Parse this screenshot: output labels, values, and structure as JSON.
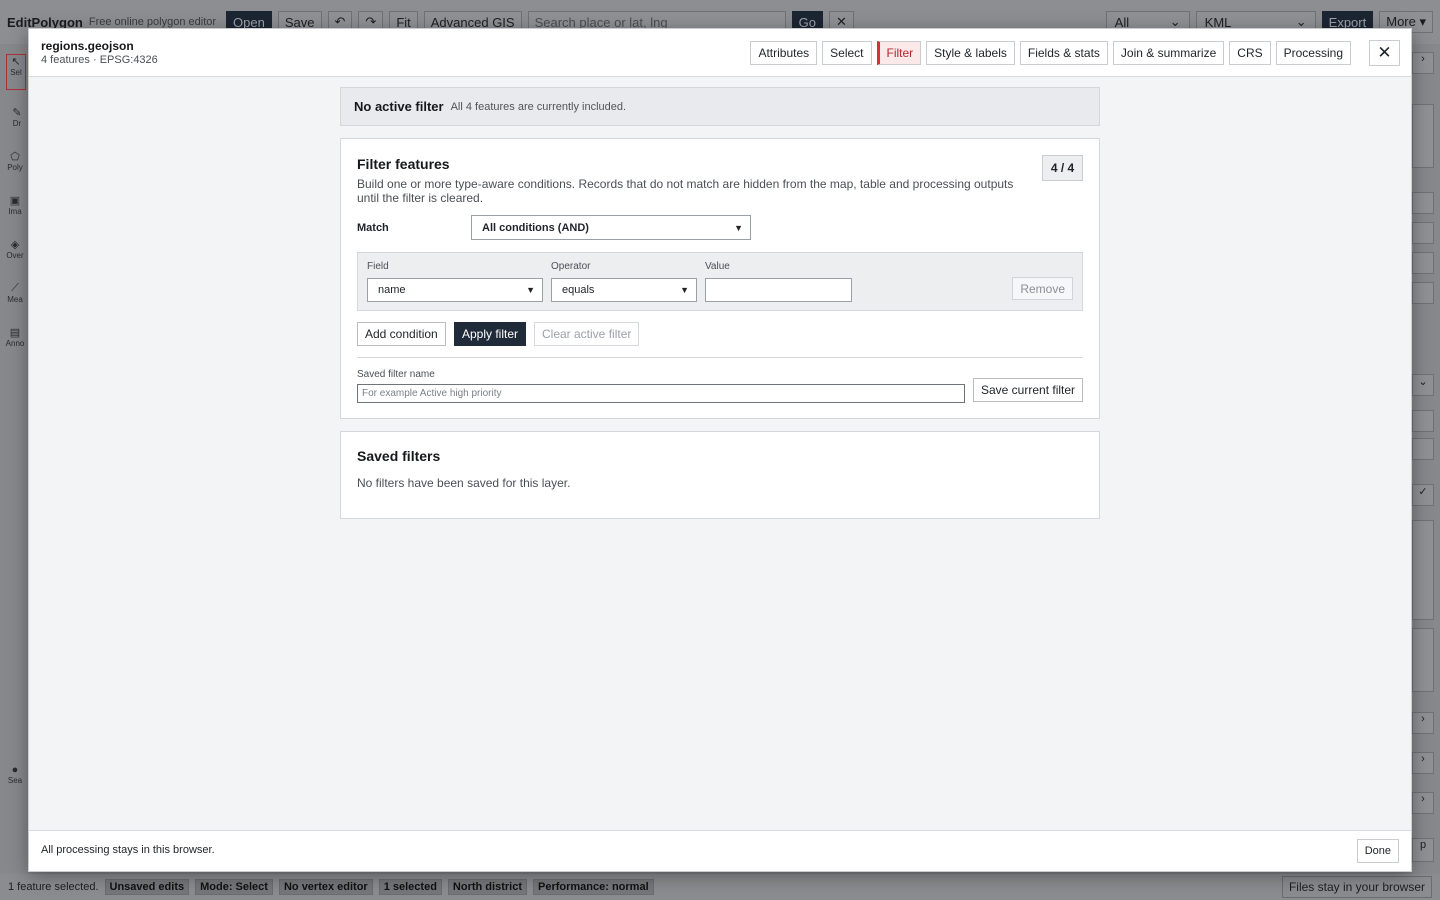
{
  "app": {
    "brand": "EditPolygon",
    "tagline": "Free online polygon editor",
    "toolbar": {
      "open_label": "Open",
      "save_label": "Save",
      "undo_glyph": "↶",
      "redo_glyph": "↷",
      "fit_label": "Fit",
      "advanced_label": "Advanced GIS",
      "search_placeholder": "Search place or lat, lng",
      "go_label": "Go",
      "clear_glyph": "✕",
      "scope_value": "All",
      "format_value": "KML",
      "export_label": "Export",
      "more_label": "More ▾"
    },
    "left_tools": [
      {
        "label": "Sel",
        "icon": "cursor-icon"
      },
      {
        "label": "Dr",
        "icon": "pencil-icon"
      },
      {
        "label": "Poly",
        "icon": "polygon-icon"
      },
      {
        "label": "Ima",
        "icon": "image-icon"
      },
      {
        "label": "Over",
        "icon": "layers-icon"
      },
      {
        "label": "Mea",
        "icon": "ruler-icon"
      },
      {
        "label": "Anno",
        "icon": "note-icon"
      },
      {
        "label": "Sea",
        "icon": "dot-icon"
      }
    ],
    "status": {
      "selected_text": "1 feature selected.",
      "chips": [
        "Unsaved edits",
        "Mode: Select",
        "No vertex editor",
        "1 selected",
        "North district",
        "Performance: normal"
      ],
      "right_text": "Files stay in your browser"
    }
  },
  "modal": {
    "layer_name": "regions.geojson",
    "layer_meta": "4 features · EPSG:4326",
    "tabs": [
      {
        "label": "Attributes",
        "active": false
      },
      {
        "label": "Select",
        "active": false
      },
      {
        "label": "Filter",
        "active": true
      },
      {
        "label": "Style & labels",
        "active": false
      },
      {
        "label": "Fields & stats",
        "active": false
      },
      {
        "label": "Join & summarize",
        "active": false
      },
      {
        "label": "CRS",
        "active": false
      },
      {
        "label": "Processing",
        "active": false
      }
    ],
    "close_glyph": "✕",
    "banner": {
      "title": "No active filter",
      "text": "All 4 features are currently included."
    },
    "filter": {
      "title": "Filter features",
      "description": "Build one or more type-aware conditions. Records that do not match are hidden from the map, table and processing outputs until the filter is cleared.",
      "count": "4 / 4",
      "match_label": "Match",
      "match_value": "All conditions (AND)",
      "condition": {
        "field_label": "Field",
        "field_value": "name",
        "operator_label": "Operator",
        "operator_value": "equals",
        "value_label": "Value",
        "value": "",
        "remove_label": "Remove"
      },
      "add_condition_label": "Add condition",
      "apply_label": "Apply filter",
      "clear_label": "Clear active filter",
      "saved_name_label": "Saved filter name",
      "saved_name_placeholder": "For example Active high priority",
      "save_label": "Save current filter"
    },
    "saved": {
      "title": "Saved filters",
      "empty_text": "No filters have been saved for this layer."
    },
    "footer": {
      "note": "All processing stays in this browser.",
      "done_label": "Done"
    }
  }
}
